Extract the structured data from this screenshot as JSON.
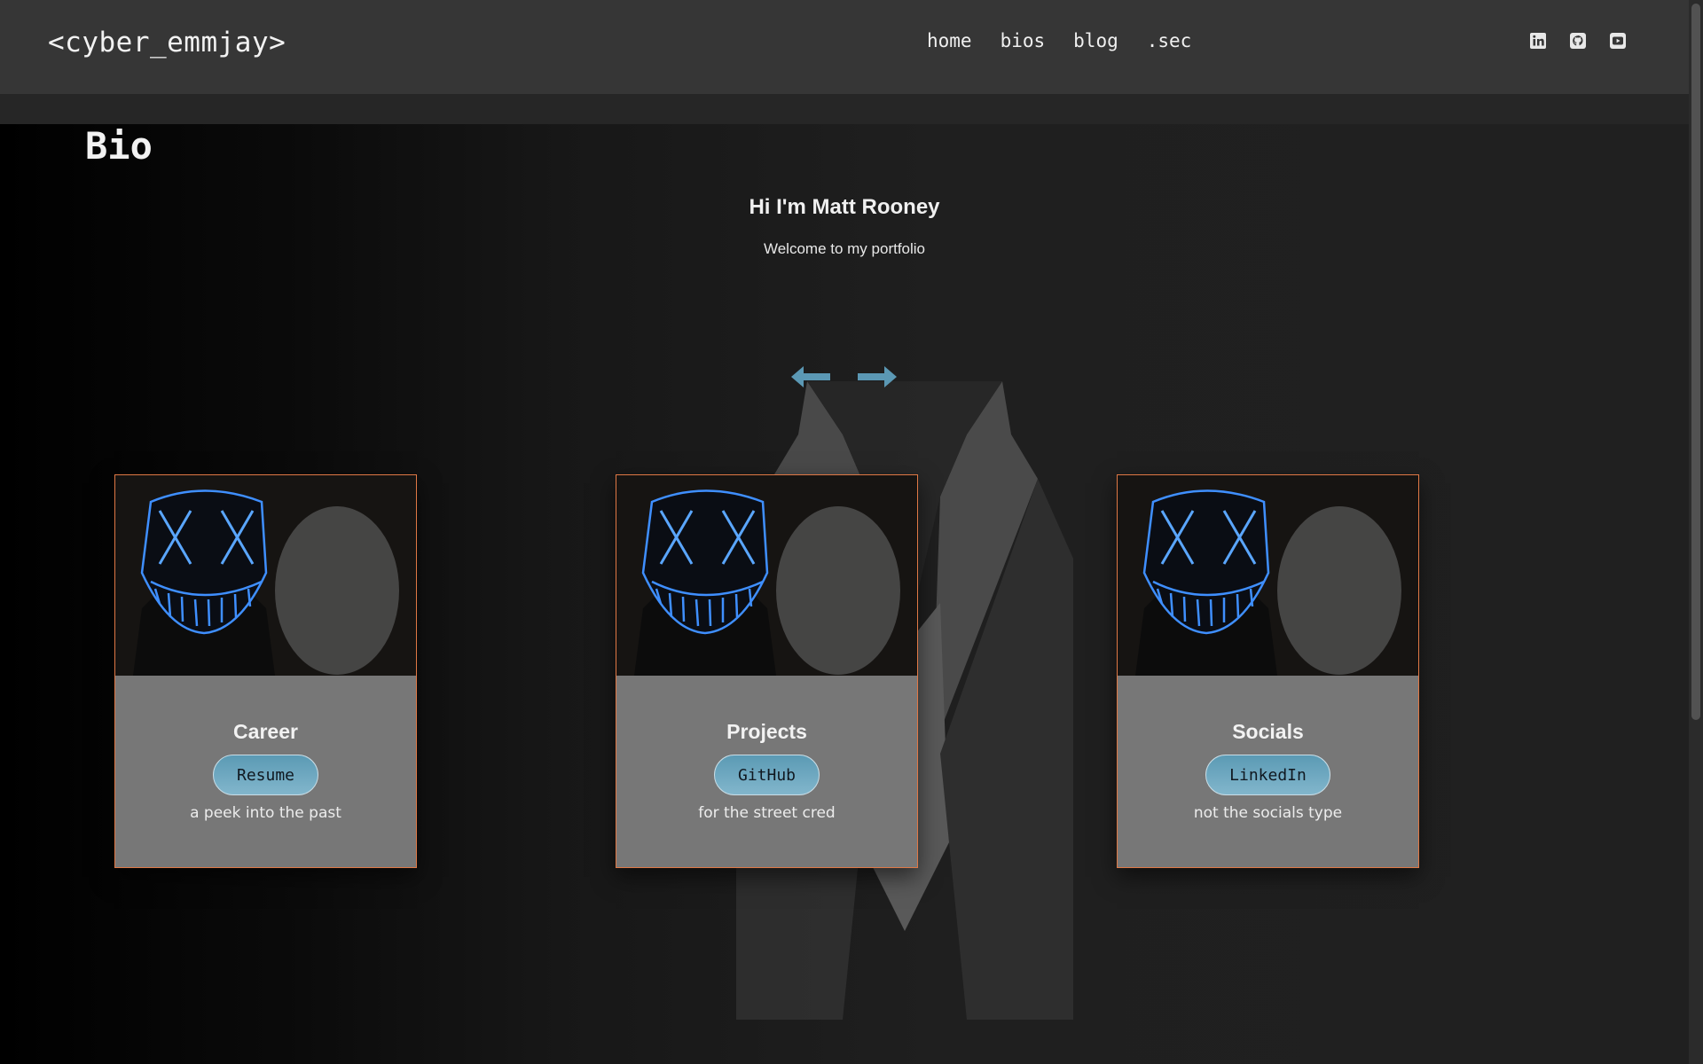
{
  "header": {
    "logo": "<cyber_emmjay>",
    "nav": [
      "home",
      "bios",
      "blog",
      ".sec"
    ],
    "social_icons": [
      "linkedin-icon",
      "github-icon",
      "youtube-icon"
    ]
  },
  "main": {
    "title": "Bio",
    "hero_name": "Hi I'm Matt Rooney",
    "hero_sub": "Welcome to my portfolio",
    "arrows": [
      "arrow-left-icon",
      "arrow-right-icon"
    ]
  },
  "cards": [
    {
      "title": "Career",
      "button": "Resume",
      "caption": "a peek into the past"
    },
    {
      "title": "Projects",
      "button": "GitHub",
      "caption": "for the street cred"
    },
    {
      "title": "Socials",
      "button": "LinkedIn",
      "caption": "not the socials type"
    }
  ],
  "colors": {
    "header_bg": "#363636",
    "accent_button": "#6ea8c1",
    "arrow": "#5b98b4",
    "card_border": "#e07845",
    "card_body": "#777777",
    "mask_glow": "#3f8fff"
  }
}
